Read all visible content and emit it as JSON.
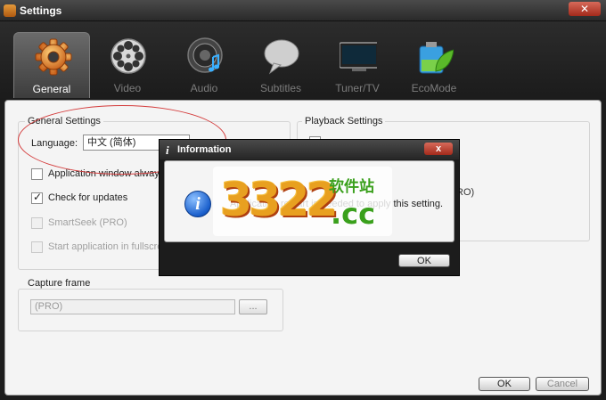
{
  "window": {
    "title": "Settings"
  },
  "tabs": [
    {
      "label": "General",
      "icon": "gear-icon",
      "active": true
    },
    {
      "label": "Video",
      "icon": "film-reel-icon",
      "active": false
    },
    {
      "label": "Audio",
      "icon": "speaker-icon",
      "active": false
    },
    {
      "label": "Subtitles",
      "icon": "speech-bubble-icon",
      "active": false
    },
    {
      "label": "Tuner/TV",
      "icon": "tv-icon",
      "active": false
    },
    {
      "label": "EcoMode",
      "icon": "battery-leaf-icon",
      "active": false
    }
  ],
  "general": {
    "group_title": "General Settings",
    "language_label": "Language:",
    "language_value": "中文 (简体)",
    "options": [
      {
        "label": "Application window always on t",
        "checked": false,
        "disabled": false
      },
      {
        "label": "Check for updates",
        "checked": true,
        "disabled": false
      },
      {
        "label": "SmartSeek (PRO)",
        "checked": false,
        "disabled": true
      },
      {
        "label": "Start application in fullscreen m",
        "checked": false,
        "disabled": true
      }
    ]
  },
  "capture": {
    "group_title": "Capture frame",
    "path_value": "(PRO)",
    "browse_label": "..."
  },
  "playback": {
    "group_title": "Playback Settings",
    "partial_text": "RO)"
  },
  "footer": {
    "ok_label": "OK",
    "cancel_label": "Cancel"
  },
  "dialog": {
    "title": "Information",
    "message": "Application restart is needed to apply this setting.",
    "ok_label": "OK",
    "close_label": "x"
  },
  "watermark": {
    "number": "3322",
    "chinese": "软件站",
    "domain": ".cc"
  },
  "colors": {
    "accent_orange": "#e49a3a",
    "highlight_red": "#d43c3c",
    "watermark_green": "#3aa01c"
  }
}
